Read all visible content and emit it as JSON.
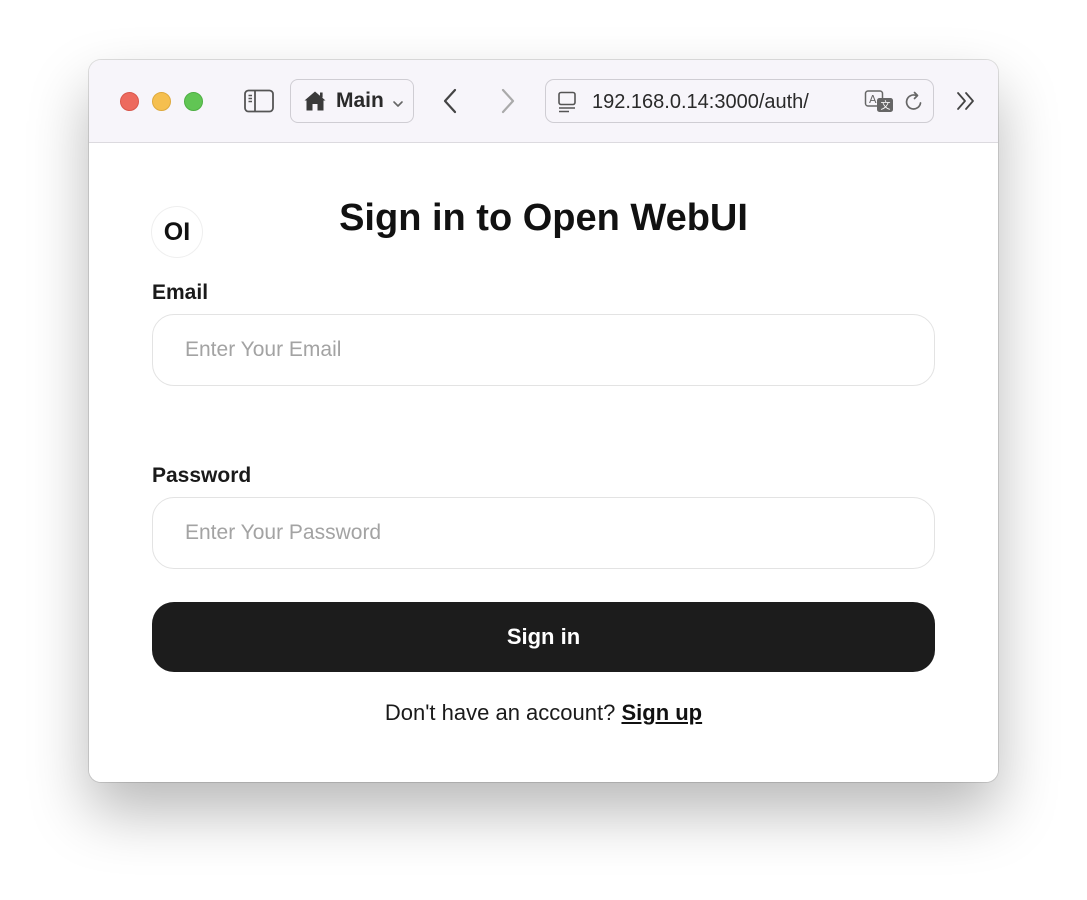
{
  "browser": {
    "tab_group_label": "Main",
    "url": "192.168.0.14:3000/auth/"
  },
  "app": {
    "logo_text": "OI",
    "title": "Sign in to Open WebUI"
  },
  "form": {
    "email_label": "Email",
    "email_placeholder": "Enter Your Email",
    "email_value": "",
    "password_label": "Password",
    "password_placeholder": "Enter Your Password",
    "password_value": "",
    "submit_label": "Sign in",
    "signup_prompt": "Don't have an account?",
    "signup_link": "Sign up"
  },
  "colors": {
    "button_bg": "#1c1c1c",
    "toolbar_bg": "#f7f5fa",
    "close": "#ed6a5e",
    "minimize": "#f5bf4f",
    "zoom": "#61c554"
  }
}
